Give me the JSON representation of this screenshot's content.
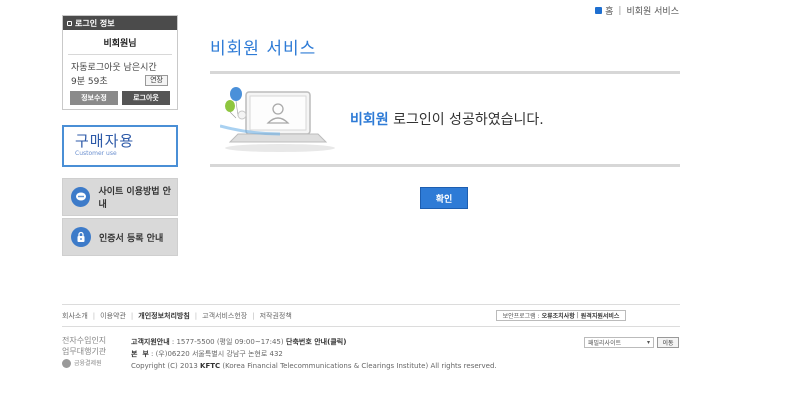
{
  "breadcrumb": {
    "home": "홈",
    "separator": "|",
    "current": "비회원 서비스"
  },
  "login": {
    "header": "로그인 정보",
    "user": "비회원님",
    "auto_logout_label": "자동로그아웃 남은시간",
    "timer": "9분 59초",
    "extend_label": "연장",
    "edit_label": "정보수정",
    "logout_label": "로그아웃"
  },
  "sidebar": {
    "purchase_title": "구매자용",
    "purchase_sub": "Customer use",
    "guide_label": "사이트 이용방법 안내",
    "cert_label": "인증서 등록 안내"
  },
  "main": {
    "title": "비회원 서비스",
    "msg_highlight": "비회원",
    "msg_rest": " 로그인이 성공하였습니다.",
    "confirm_label": "확인"
  },
  "footer": {
    "links": [
      "회사소개",
      "이용약관",
      "개인정보처리방침",
      "고객서비스헌장",
      "저작권정책"
    ],
    "sec_prefix": "보안프로그램 :",
    "sec_link1": "오류조치사항",
    "sec_sep": "|",
    "sec_link2": "원격지원서비스",
    "logo_line1": "전자수입인지",
    "logo_line2": "업무대행기관",
    "logo_org": "금융결제원",
    "info_line1_label": "고객지원안내",
    "info_line1_text": " : 1577-5500 (평일 09:00~17:45)",
    "info_line1_extra": " 단축번호 안내(클릭)",
    "info_line2_label": "본  부",
    "info_line2_text": " : (우)06220 서울특별시 강남구 논현로 432",
    "info_line3_pre": "Copyright (C) 2013 ",
    "info_line3_bold": "KFTC",
    "info_line3_post": " (Korea Financial Telecommunications & Clearings Institute) All rights reserved.",
    "family_site": "패밀리사이트",
    "go_label": "이동"
  }
}
